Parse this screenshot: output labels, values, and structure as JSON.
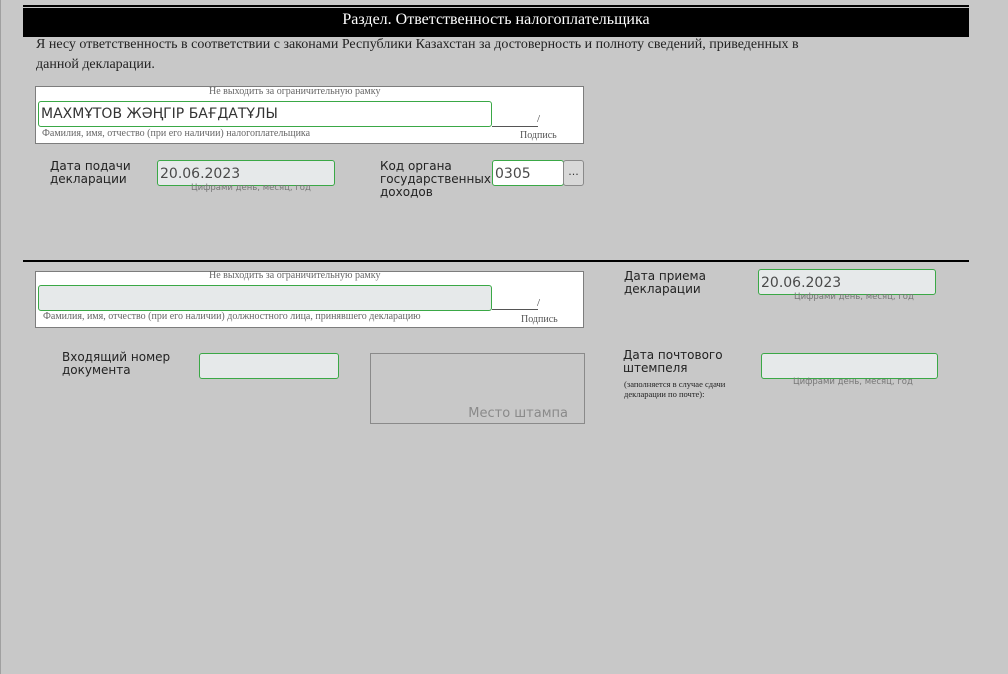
{
  "section": {
    "title": "Раздел. Ответственность налогоплательщика",
    "declaration_text": "Я несу ответственность  в соответствии с  законами Республики Казахстан за достоверность и полноту сведений, приведенных в данной декларации."
  },
  "taxpayer": {
    "frame_hint": "Не выходить за ограничительную рамку",
    "name_value": "МАХМҰТОВ ЖӘҢГІР БАҒДАТҰЛЫ",
    "name_caption": "Фамилия, имя, отчество (при его наличии) налогоплательщика",
    "signature_slash": "/",
    "signature_label": "Подпись",
    "submission_date_label": "Дата подачи декларации",
    "submission_date_value": "20.06.2023",
    "date_hint": "Цифрами день, месяц, год",
    "revenue_code_label": "Код органа государственных доходов",
    "revenue_code_value": "0305",
    "lookup_button_label": "..."
  },
  "official": {
    "frame_hint": "Не выходить за ограничительную рамку",
    "name_value": "",
    "name_caption": "Фамилия, имя, отчество (при его наличии) должностного лица, принявшего декларацию",
    "signature_slash": "/",
    "signature_label": "Подпись",
    "receipt_date_label": "Дата приема декларации",
    "receipt_date_value": "20.06.2023",
    "receipt_date_hint": "Цифрами день, месяц, год",
    "incoming_number_label": "Входящий номер документа",
    "incoming_number_value": "",
    "stamp_placeholder": "Место штампа",
    "postmark_date_label": "Дата почтового штемпеля",
    "postmark_note": "(заполняется в случае сдачи декларации по почте):",
    "postmark_date_value": "",
    "postmark_date_hint": "Цифрами день, месяц, год"
  },
  "colors": {
    "background": "#c8c8c8",
    "header_bg": "#000000",
    "field_border": "#3aa846",
    "field_bg": "#e6e9ea"
  }
}
